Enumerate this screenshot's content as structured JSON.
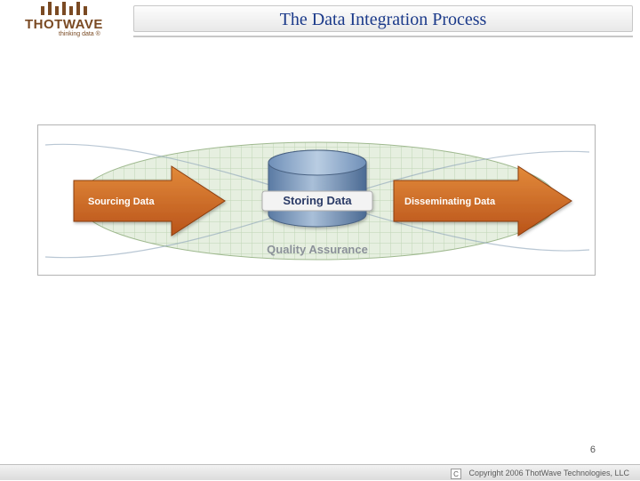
{
  "header": {
    "title": "The Data Integration Process",
    "logo_word": "THOTWAVE",
    "logo_tagline": "thinking data ®"
  },
  "diagram": {
    "stage1": "Sourcing Data",
    "stage2": "Storing Data",
    "stage3": "Disseminating Data",
    "qa": "Quality Assurance"
  },
  "page_number": "6",
  "footer": {
    "c": "C",
    "copyright": "Copyright 2006 ThotWave Technologies, LLC"
  }
}
